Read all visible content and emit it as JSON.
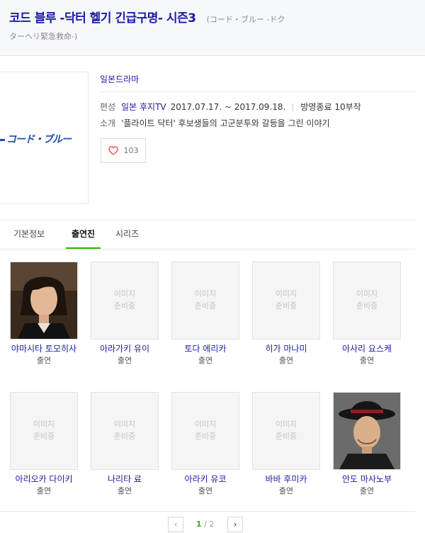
{
  "header": {
    "title": "코드 블루 -닥터 헬기 긴급구명- 시즌3",
    "original_title_part1": "(コード・ブルー -ドク",
    "original_title_part2": "ターヘリ緊急救命-)"
  },
  "poster": {
    "logo_text": "コード・ブルー"
  },
  "info": {
    "genre": "일본드라마",
    "schedule_label": "편성",
    "broadcaster": "일본 후지TV",
    "period": "2017.07.17. ~ 2017.09.18.",
    "status": "방영종료 10부작",
    "summary_label": "소개",
    "summary": "'플라이트 닥터' 후보생들의 고군분투와 갈등을 그린 이야기"
  },
  "like": {
    "count": "103"
  },
  "tabs": [
    "기본정보",
    "출연진",
    "시리즈"
  ],
  "active_tab": "출연진",
  "placeholder_text": {
    "line1": "이미지",
    "line2": "준비중"
  },
  "cast": [
    {
      "name": "야마시타 토모히사",
      "role": "출연",
      "has_photo": true
    },
    {
      "name": "아라가키 유이",
      "role": "출연",
      "has_photo": false
    },
    {
      "name": "토다 에리카",
      "role": "출연",
      "has_photo": false
    },
    {
      "name": "히가 마나미",
      "role": "출연",
      "has_photo": false
    },
    {
      "name": "아사리 요스케",
      "role": "출연",
      "has_photo": false
    },
    {
      "name": "아리오카 다이키",
      "role": "출연",
      "has_photo": false
    },
    {
      "name": "나리타 료",
      "role": "출연",
      "has_photo": false
    },
    {
      "name": "아라키 유코",
      "role": "출연",
      "has_photo": false
    },
    {
      "name": "바바 후미카",
      "role": "출연",
      "has_photo": false
    },
    {
      "name": "안도 마사노부",
      "role": "출연",
      "has_photo": true
    }
  ],
  "pagination": {
    "current": "1",
    "separator": "/",
    "total": "2"
  },
  "colors": {
    "link": "#1a1aa6",
    "accent_green": "#2db400",
    "heart": "#e85a5a"
  }
}
